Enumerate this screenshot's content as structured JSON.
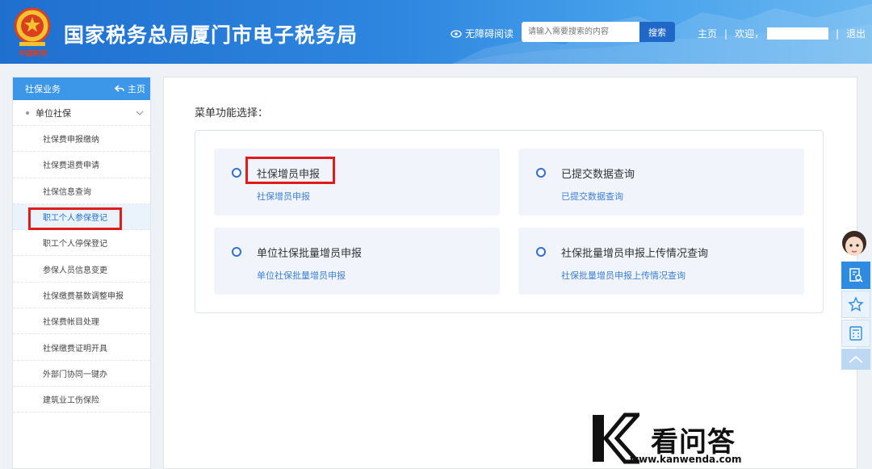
{
  "header": {
    "title": "国家税务总局厦门市电子税务局",
    "emblem_text": "中国税务",
    "accessibility_label": "无障碍阅读",
    "search": {
      "placeholder": "请输入需要搜索的内容",
      "button_label": "搜索"
    },
    "nav": {
      "home_label": "主页",
      "welcome_label": "欢迎，",
      "logout_label": "退出"
    }
  },
  "sidebar": {
    "title": "社保业务",
    "home_label": "主页",
    "group_label": "单位社保",
    "items": [
      {
        "label": "社保费申报缴纳"
      },
      {
        "label": "社保费退费申请"
      },
      {
        "label": "社保信息查询"
      },
      {
        "label": "职工个人参保登记"
      },
      {
        "label": "职工个人停保登记"
      },
      {
        "label": "参保人员信息变更"
      },
      {
        "label": "社保缴费基数调整申报"
      },
      {
        "label": "社保费帐目处理"
      },
      {
        "label": "社保缴费证明开具"
      },
      {
        "label": "外部门协同一键办"
      },
      {
        "label": "建筑业工伤保险"
      }
    ],
    "active_item": "职工个人参保登记"
  },
  "main": {
    "menu_title": "菜单功能选择：",
    "options": [
      {
        "title": "社保增员申报",
        "subtitle": "社保增员申报"
      },
      {
        "title": "已提交数据查询",
        "subtitle": "已提交数据查询"
      },
      {
        "title": "单位社保批量增员申报",
        "subtitle": "单位社保批量增员申报"
      },
      {
        "title": "社保批量增员申报上传情况查询",
        "subtitle": "社保批量增员申报上传情况查询"
      }
    ]
  },
  "float_bar": {
    "icons": [
      "search-doc-icon",
      "star-icon",
      "calculator-icon",
      "chevron-up-icon"
    ]
  },
  "watermark": {
    "brand": "看问答",
    "url": "www.kanwenda.com"
  },
  "colors": {
    "header": "#2e86df",
    "sidebar_head": "#3d97e8",
    "link": "#3d7fd6",
    "highlight": "#e21a1a"
  }
}
